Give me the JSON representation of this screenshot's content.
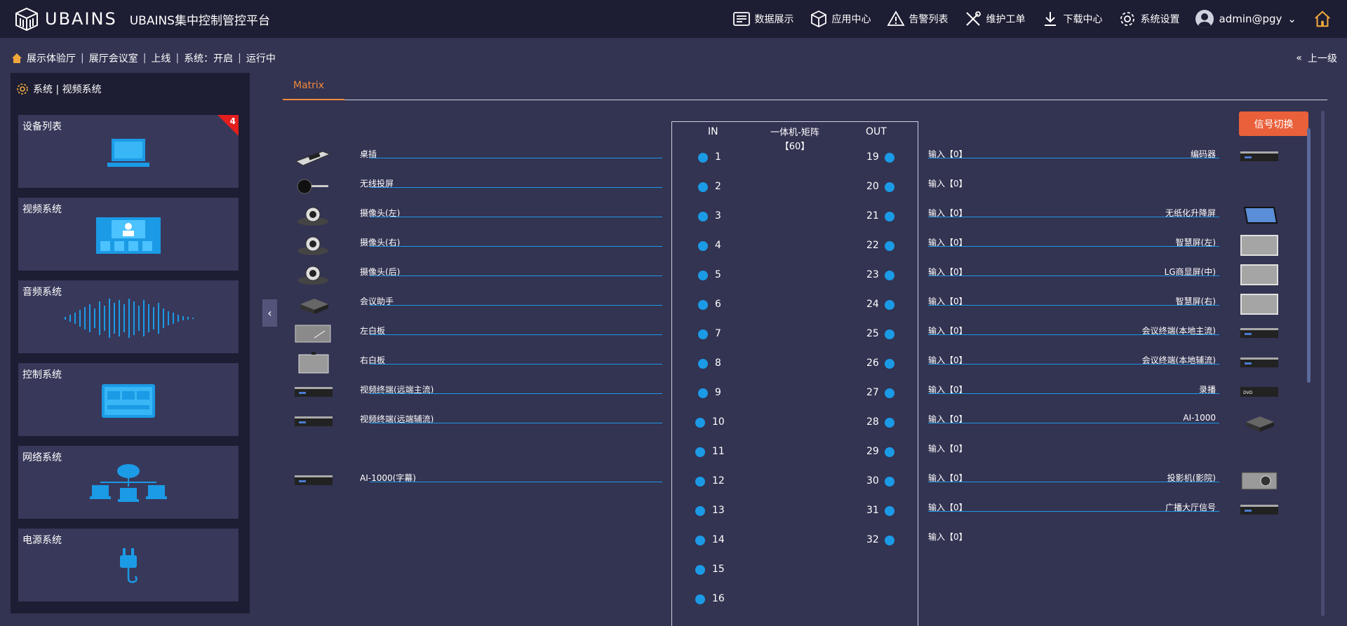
{
  "app": {
    "brand": "UBAINS",
    "platform_title": "UBAINS集中控制管控平台"
  },
  "nav": {
    "items": [
      {
        "label": "数据展示",
        "icon": "data-display-icon"
      },
      {
        "label": "应用中心",
        "icon": "cube-icon"
      },
      {
        "label": "告警列表",
        "icon": "warning-icon"
      },
      {
        "label": "维护工单",
        "icon": "tools-icon"
      },
      {
        "label": "下载中心",
        "icon": "download-icon"
      },
      {
        "label": "系统设置",
        "icon": "gear-icon"
      }
    ],
    "user": "admin@pgy"
  },
  "breadcrumb": {
    "venue": "展示体验厅",
    "room": "展厅会议室",
    "online": "上线",
    "system": "系统：开启",
    "state": "运行中"
  },
  "back_label": "上一级",
  "sidebar": {
    "header": "系统 | 视频系统",
    "cards": [
      {
        "label": "设备列表",
        "badge": "4"
      },
      {
        "label": "视频系统"
      },
      {
        "label": "音频系统"
      },
      {
        "label": "控制系统"
      },
      {
        "label": "网络系统"
      },
      {
        "label": "电源系统"
      }
    ]
  },
  "tab": "Matrix",
  "switch_button": "信号切换",
  "matrix": {
    "in_title": "IN",
    "out_title": "OUT",
    "name_line1": "一体机-矩阵",
    "name_line2": "【60】",
    "inputs": [
      "1",
      "2",
      "3",
      "4",
      "5",
      "6",
      "7",
      "8",
      "9",
      "10",
      "11",
      "12",
      "13",
      "14",
      "15",
      "16"
    ],
    "outputs": [
      "19",
      "20",
      "21",
      "22",
      "23",
      "24",
      "25",
      "26",
      "27",
      "28",
      "29",
      "30",
      "31",
      "32"
    ]
  },
  "sources": [
    {
      "label": "桌插",
      "row": 0
    },
    {
      "label": "无线投屏",
      "row": 1
    },
    {
      "label": "摄像头(左)",
      "row": 2
    },
    {
      "label": "摄像头(右)",
      "row": 3
    },
    {
      "label": "摄像头(后)",
      "row": 4
    },
    {
      "label": "会议助手",
      "row": 5
    },
    {
      "label": "左白板",
      "row": 6
    },
    {
      "label": "右白板",
      "row": 7
    },
    {
      "label": "视频终端(远端主流)",
      "row": 8
    },
    {
      "label": "视频终端(远端辅流)",
      "row": 9
    },
    {
      "label": "AI-1000(字幕)",
      "row": 11
    }
  ],
  "outputs": [
    {
      "input": "输入【0】",
      "device": "编码器"
    },
    {
      "input": "输入【0】",
      "device": ""
    },
    {
      "input": "输入【0】",
      "device": "无纸化升降屏"
    },
    {
      "input": "输入【0】",
      "device": "智慧屏(左)"
    },
    {
      "input": "输入【0】",
      "device": "LG商显屏(中)"
    },
    {
      "input": "输入【0】",
      "device": "智慧屏(右)"
    },
    {
      "input": "输入【0】",
      "device": "会议终端(本地主流)"
    },
    {
      "input": "输入【0】",
      "device": "会议终端(本地辅流)"
    },
    {
      "input": "输入【0】",
      "device": "录播"
    },
    {
      "input": "输入【0】",
      "device": "AI-1000"
    },
    {
      "input": "输入【0】",
      "device": ""
    },
    {
      "input": "输入【0】",
      "device": "投影机(影院)"
    },
    {
      "input": "输入【0】",
      "device": "广播大厅信号"
    },
    {
      "input": "输入【0】",
      "device": ""
    }
  ],
  "colors": {
    "accent": "#f08a3c",
    "dot": "#1b9ae6",
    "button": "#e9603a"
  }
}
